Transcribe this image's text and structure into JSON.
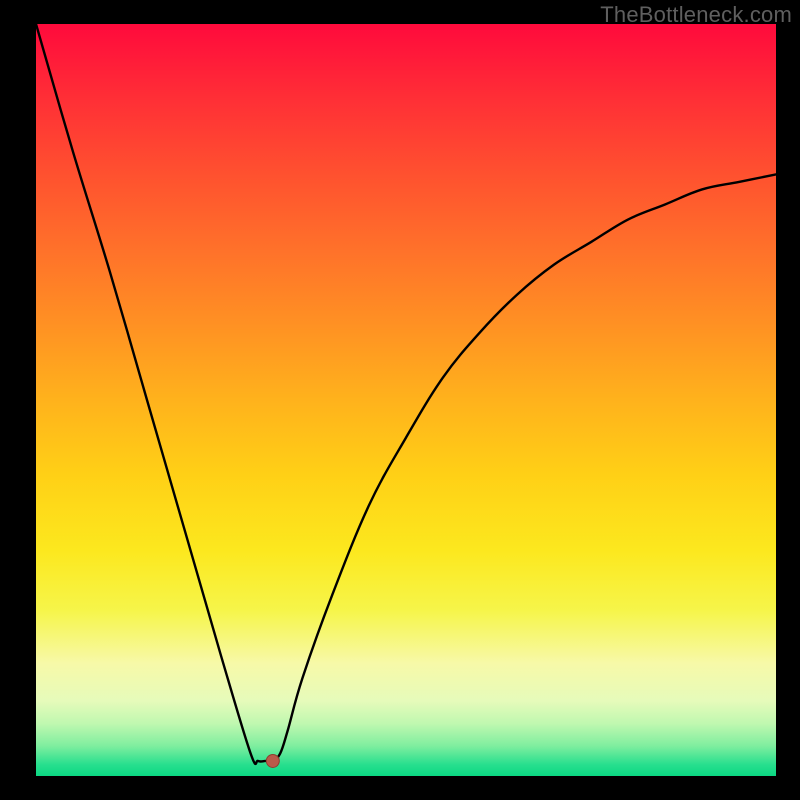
{
  "watermark": "TheBottleneck.com",
  "chart_data": {
    "type": "line",
    "title": "",
    "xlabel": "",
    "ylabel": "",
    "xlim": [
      0,
      100
    ],
    "ylim": [
      0,
      100
    ],
    "x": [
      0,
      5,
      10,
      15,
      20,
      25,
      29,
      30,
      31,
      32,
      33,
      34,
      36,
      40,
      45,
      50,
      55,
      60,
      65,
      70,
      75,
      80,
      85,
      90,
      95,
      100
    ],
    "values": [
      100,
      83,
      67,
      50,
      33,
      16,
      3,
      2,
      2,
      2,
      3,
      6,
      13,
      24,
      36,
      45,
      53,
      59,
      64,
      68,
      71,
      74,
      76,
      78,
      79,
      80
    ],
    "marker_point": {
      "x": 32,
      "y": 2
    },
    "background": "rainbow-vertical",
    "gradient_stops": [
      {
        "offset": 0.0,
        "color": "#ff0a3c"
      },
      {
        "offset": 0.1,
        "color": "#ff2f36"
      },
      {
        "offset": 0.2,
        "color": "#ff512f"
      },
      {
        "offset": 0.3,
        "color": "#ff712a"
      },
      {
        "offset": 0.4,
        "color": "#ff9123"
      },
      {
        "offset": 0.5,
        "color": "#ffb21c"
      },
      {
        "offset": 0.6,
        "color": "#ffd016"
      },
      {
        "offset": 0.7,
        "color": "#fce81e"
      },
      {
        "offset": 0.78,
        "color": "#f6f54a"
      },
      {
        "offset": 0.85,
        "color": "#f7f9a8"
      },
      {
        "offset": 0.9,
        "color": "#e6fbba"
      },
      {
        "offset": 0.93,
        "color": "#c0f8b0"
      },
      {
        "offset": 0.96,
        "color": "#7fee9f"
      },
      {
        "offset": 0.985,
        "color": "#27df8e"
      },
      {
        "offset": 1.0,
        "color": "#0bd783"
      }
    ]
  }
}
